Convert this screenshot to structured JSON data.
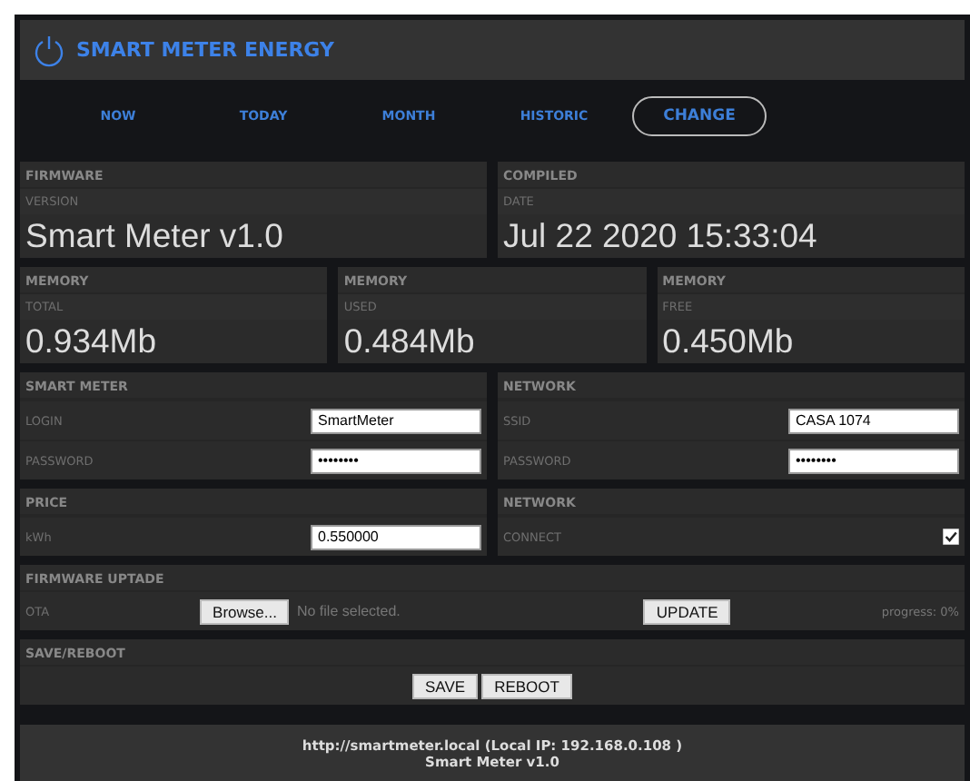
{
  "header": {
    "title": "SMART METER ENERGY"
  },
  "nav": [
    {
      "label": "NOW",
      "selected": false
    },
    {
      "label": "TODAY",
      "selected": false
    },
    {
      "label": "MONTH",
      "selected": false
    },
    {
      "label": "HISTORIC",
      "selected": false
    },
    {
      "label": "CHANGE",
      "selected": true
    }
  ],
  "rows": [
    {
      "panels": [
        {
          "kind": "value",
          "title": "FIRMWARE",
          "label": "VERSION",
          "value": "Smart Meter v1.0"
        },
        {
          "kind": "value",
          "title": "COMPILED",
          "label": "DATE",
          "value": "Jul 22 2020 15:33:04"
        }
      ]
    },
    {
      "panels": [
        {
          "kind": "value",
          "title": "MEMORY",
          "label": "TOTAL",
          "value": "0.934Mb"
        },
        {
          "kind": "value",
          "title": "MEMORY",
          "label": "USED",
          "value": "0.484Mb"
        },
        {
          "kind": "value",
          "title": "MEMORY",
          "label": "FREE",
          "value": "0.450Mb"
        }
      ]
    },
    {
      "panels": [
        {
          "kind": "form",
          "title": "SMART METER",
          "fields": [
            {
              "kind": "text",
              "label": "LOGIN",
              "value": "SmartMeter"
            },
            {
              "kind": "text",
              "label": "PASSWORD",
              "value": "••••••••"
            }
          ]
        },
        {
          "kind": "form",
          "title": "NETWORK",
          "fields": [
            {
              "kind": "text",
              "label": "SSID",
              "value": "CASA 1074"
            },
            {
              "kind": "text",
              "label": "PASSWORD",
              "value": "••••••••"
            }
          ]
        }
      ]
    },
    {
      "panels": [
        {
          "kind": "form",
          "title": "PRICE",
          "fields": [
            {
              "kind": "text",
              "label": "kWh",
              "value": "0.550000"
            }
          ]
        },
        {
          "kind": "form",
          "title": "NETWORK",
          "fields": [
            {
              "kind": "checkbox",
              "label": "CONNECT",
              "checked": true
            }
          ]
        }
      ]
    },
    {
      "panels": [
        {
          "kind": "upload",
          "title": "FIRMWARE UPTADE",
          "label": "OTA",
          "browse": "Browse...",
          "file": "No file selected.",
          "button": "UPDATE",
          "progress": "progress: 0%"
        }
      ]
    },
    {
      "panels": [
        {
          "kind": "actions",
          "title": "SAVE/REBOOT",
          "buttons": [
            "SAVE",
            "REBOOT"
          ]
        }
      ]
    }
  ],
  "footer": [
    "http://smartmeter.local (Local IP: 192.168.0.108 )",
    "Smart Meter v1.0"
  ]
}
